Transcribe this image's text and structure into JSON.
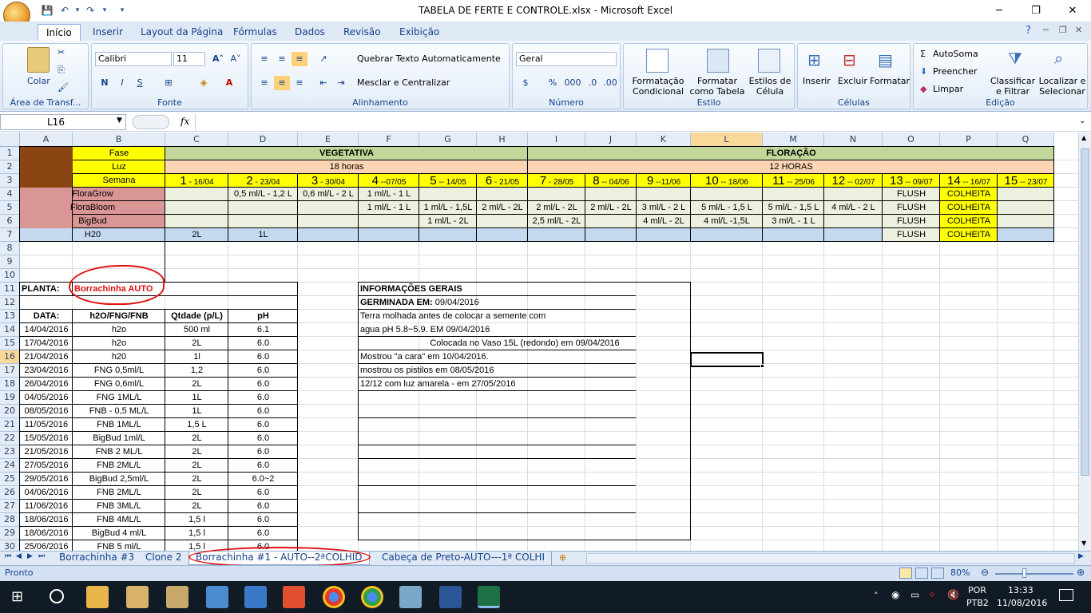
{
  "window": {
    "title": "TABELA DE FERTE E CONTROLE.xlsx - Microsoft Excel"
  },
  "ribbon_tabs": [
    "Início",
    "Inserir",
    "Layout da Página",
    "Fórmulas",
    "Dados",
    "Revisão",
    "Exibição"
  ],
  "ribbon": {
    "clipboard": {
      "paste": "Colar",
      "label": "Área de Transf..."
    },
    "font": {
      "name": "Calibri",
      "size": "11",
      "label": "Fonte",
      "bold": "N",
      "italic": "I",
      "underline": "S"
    },
    "alignment": {
      "wrap": "Quebrar Texto Automaticamente",
      "merge": "Mesclar e Centralizar",
      "label": "Alinhamento"
    },
    "number": {
      "format": "Geral",
      "label": "Número",
      "percent": "%",
      "thousands": "000"
    },
    "styles": {
      "cond": "Formatação Condicional",
      "table": "Formatar como Tabela",
      "cell": "Estilos de Célula",
      "label": "Estilo"
    },
    "cells": {
      "insert": "Inserir",
      "delete": "Excluir",
      "format": "Formatar",
      "label": "Células"
    },
    "editing": {
      "autosum": "AutoSoma",
      "fill": "Preencher",
      "clear": "Limpar",
      "sort": "Classificar e Filtrar",
      "find": "Localizar e Selecionar",
      "label": "Edição"
    }
  },
  "namebox": "L16",
  "fx": "fx",
  "columns": [
    "A",
    "B",
    "C",
    "D",
    "E",
    "F",
    "G",
    "H",
    "I",
    "J",
    "K",
    "L",
    "M",
    "N",
    "O",
    "P",
    "Q"
  ],
  "rows": [
    "1",
    "2",
    "3",
    "4",
    "5",
    "6",
    "7",
    "8",
    "9",
    "10",
    "11",
    "12",
    "13",
    "14",
    "15",
    "16",
    "17",
    "18",
    "19",
    "20",
    "21",
    "22",
    "23",
    "24",
    "25",
    "26",
    "27",
    "28",
    "29",
    "30"
  ],
  "schedule": {
    "fase": "Fase",
    "luz": "Luz",
    "semana": "Semana",
    "vegetativa": "VEGETATIVA",
    "floracao": "FLORAÇÃO",
    "h18": "18 horas",
    "h12": "12 HORAS",
    "weeks": [
      [
        "1",
        "- 16/04"
      ],
      [
        "2",
        "- 23/04"
      ],
      [
        "3",
        "- 30/04"
      ],
      [
        "4",
        "--07/05"
      ],
      [
        "5",
        "-- 14/05"
      ],
      [
        "6",
        "- 21/05"
      ],
      [
        "7",
        "- 28/05"
      ],
      [
        "8",
        "-- 04/06"
      ],
      [
        "9",
        "--11/06"
      ],
      [
        "10",
        "-- 18/06"
      ],
      [
        "11",
        "-- 25/06"
      ],
      [
        "12",
        "-- 02/07"
      ],
      [
        "13",
        "-- 09/07"
      ],
      [
        "14",
        "-- 16/07"
      ],
      [
        "15",
        "-- 23/07"
      ]
    ],
    "floragrow": {
      "label": "FloraGrow",
      "d": "0,5 ml/L - 1,2 L",
      "e": "0,6 ml/L - 2 L",
      "f": "1 ml/L - 1 L",
      "o": "FLUSH",
      "p": "COLHEITA"
    },
    "florabloom": {
      "label": "FloraBloom",
      "f": "1 ml/L - 1 L",
      "g": "1 ml/L - 1,5L",
      "h": "2 ml/L - 2L",
      "i": "2 ml/L - 2L",
      "j": "2 ml/L - 2L",
      "k": "3 ml/L - 2 L",
      "l": "5 ml/L - 1,5 L",
      "m": "5 ml/L - 1,5 L",
      "n": "4 ml/L - 2 L",
      "o": "FLUSH",
      "p": "COLHEITA"
    },
    "bigbud": {
      "label": "BigBud",
      "g": "1 ml/L - 2L",
      "i": "2,5 ml/L - 2L",
      "k": "4 ml/L - 2L",
      "l": "4 ml/L -1,5L",
      "m": "3 ml/L - 1 L",
      "o": "FLUSH",
      "p": "COLHEITA"
    },
    "h20": {
      "label": "H20",
      "c": "2L",
      "d": "1L",
      "o": "FLUSH",
      "p": "COLHEITA"
    }
  },
  "planta": {
    "label": "PLANTA:",
    "name": "Borrachinha AUTO"
  },
  "log": {
    "headers": [
      "DATA:",
      "h2O/FNG/FNB",
      "Qtdade (p/L)",
      "pH"
    ],
    "rows": [
      [
        "14/04/2016",
        "h2o",
        "500 ml",
        "6.1"
      ],
      [
        "17/04/2016",
        "h2o",
        "2L",
        "6.0"
      ],
      [
        "21/04/2016",
        "h20",
        "1l",
        "6.0"
      ],
      [
        "23/04/2016",
        "FNG 0,5ml/L",
        "1,2",
        "6.0"
      ],
      [
        "26/04/2016",
        "FNG 0,6ml/L",
        "2L",
        "6.0"
      ],
      [
        "04/05/2016",
        "FNG 1ML/L",
        "1L",
        "6.0"
      ],
      [
        "08/05/2016",
        "FNB - 0,5 ML/L",
        "1L",
        "6.0"
      ],
      [
        "11/05/2016",
        "FNB 1ML/L",
        "1,5 L",
        "6.0"
      ],
      [
        "15/05/2016",
        "BigBud 1ml/L",
        "2L",
        "6.0"
      ],
      [
        "21/05/2016",
        "FNB 2 ML/L",
        "2L",
        "6.0"
      ],
      [
        "27/05/2016",
        "FNB 2ML/L",
        "2L",
        "6.0"
      ],
      [
        "29/05/2016",
        "BigBud 2,5ml/L",
        "2L",
        "6.0~2"
      ],
      [
        "04/06/2016",
        "FNB 2ML/L",
        "2L",
        "6.0"
      ],
      [
        "11/06/2016",
        "FNB 3ML/L",
        "2L",
        "6.0"
      ],
      [
        "18/06/2016",
        "FNB 4ML/L",
        "1,5 l",
        "6.0"
      ],
      [
        "18/06/2016",
        "BigBud 4 ml/L",
        "1,5 l",
        "6.0"
      ],
      [
        "25/06/2016",
        "FNB 5 ml/L",
        "1,5 l",
        "6.0"
      ]
    ]
  },
  "info": {
    "title": "INFORMAÇÕES GERAIS",
    "germ_label": "GERMINADA EM:",
    "germ_date": "09/04/2016",
    "lines": [
      "Terra molhada antes de colocar a semente com",
      "agua pH 5.8~5.9. EM 09/04/2016",
      "Colocada no Vaso 15L (redondo) em 09/04/2016",
      "Mostrou \"a cara\" em 10/04/2016.",
      "mostrou os pistilos em 08/05/2016",
      "12/12 com luz amarela - em 27/05/2016"
    ]
  },
  "sheets": [
    "Borrachinha #3",
    "Clone 2",
    "Borrachinha #1 - AUTO--2ªCOLHID",
    "Cabeça de Preto-AUTO---1ª COLHI"
  ],
  "status": {
    "ready": "Pronto",
    "zoom": "80%"
  },
  "taskbar": {
    "lang1": "POR",
    "lang2": "PTB2",
    "time": "13:33",
    "date": "11/08/2016"
  },
  "colors": {
    "brown": "#8b4513",
    "yellow": "#ffff00",
    "green": "#c4d79b",
    "peach": "#fcd5b4",
    "pink": "#da9694",
    "lightgreen": "#ebf1de",
    "blue": "#c5d9f1",
    "red": "#e01010"
  }
}
